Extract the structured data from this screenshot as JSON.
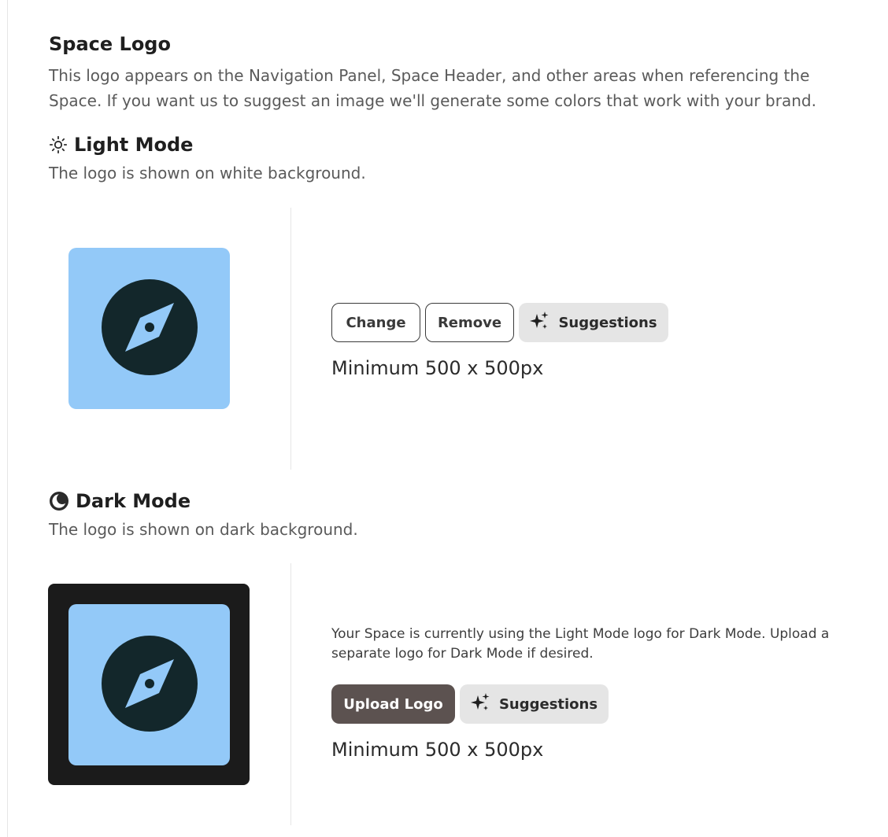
{
  "space_logo": {
    "title": "Space Logo",
    "description": "This logo appears on the Navigation Panel, Space Header, and other areas when referencing the Space. If you want us to suggest an image we'll generate some colors that work with your brand."
  },
  "light_mode": {
    "icon": "sun-icon",
    "title": "Light Mode",
    "description": "The logo is shown on white background.",
    "buttons": {
      "change": "Change",
      "remove": "Remove",
      "suggestions": "Suggestions"
    },
    "min_size": "Minimum 500 x 500px"
  },
  "dark_mode": {
    "icon": "moon-icon",
    "title": "Dark Mode",
    "description": "The logo is shown on dark background.",
    "notice": "Your Space is currently using the Light Mode logo for Dark Mode. Upload a separate logo for Dark Mode if desired.",
    "buttons": {
      "upload": "Upload Logo",
      "suggestions": "Suggestions"
    },
    "min_size": "Minimum 500 x 500px"
  },
  "logo": {
    "icon": "compass-icon",
    "tile_color": "#93c9f8",
    "glyph_color": "#13272b",
    "dark_background": "#1b1b1b"
  }
}
